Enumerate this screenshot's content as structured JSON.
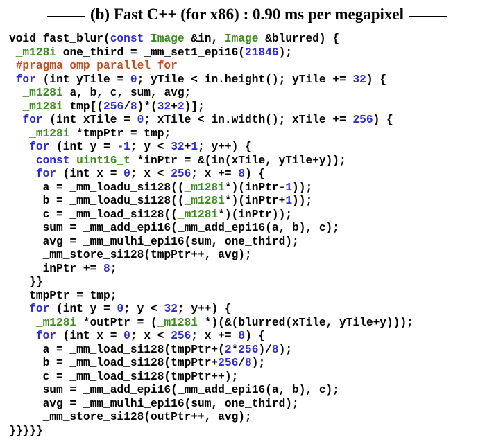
{
  "header": {
    "title": "(b) Fast C++ (for x86) : 0.90 ms per megapixel"
  },
  "colors": {
    "keyword": "#2b2bd6",
    "type": "#3d8a1f",
    "preprocessor": "#c84c1a",
    "number": "#2b2bd6",
    "text": "#000000"
  },
  "code": {
    "lines": [
      [
        [
          "void fast_blur(",
          ""
        ],
        [
          "const",
          "kw"
        ],
        [
          " ",
          ""
        ],
        [
          "Image",
          "ty"
        ],
        [
          " &in, ",
          ""
        ],
        [
          "Image",
          "ty"
        ],
        [
          " &blurred) {",
          ""
        ]
      ],
      [
        [
          " ",
          ""
        ],
        [
          "_m128i",
          "ty"
        ],
        [
          " one_third = _mm_set1_epi16(",
          ""
        ],
        [
          "21846",
          "nm"
        ],
        [
          ");",
          ""
        ]
      ],
      [
        [
          " ",
          ""
        ],
        [
          "#pragma omp parallel for",
          "pp"
        ]
      ],
      [
        [
          " ",
          ""
        ],
        [
          "for",
          "kw"
        ],
        [
          " (int yTile = ",
          ""
        ],
        [
          "0",
          "nm"
        ],
        [
          "; yTile < in.height(); yTile += ",
          ""
        ],
        [
          "32",
          "nm"
        ],
        [
          ") {",
          ""
        ]
      ],
      [
        [
          "  ",
          ""
        ],
        [
          "_m128i",
          "ty"
        ],
        [
          " a, b, c, sum, avg;",
          ""
        ]
      ],
      [
        [
          "  ",
          ""
        ],
        [
          "_m128i",
          "ty"
        ],
        [
          " tmp[(",
          ""
        ],
        [
          "256",
          "nm"
        ],
        [
          "/",
          ""
        ],
        [
          "8",
          "nm"
        ],
        [
          ")*(",
          ""
        ],
        [
          "32",
          "nm"
        ],
        [
          "+",
          ""
        ],
        [
          "2",
          "nm"
        ],
        [
          ")];",
          ""
        ]
      ],
      [
        [
          "  ",
          ""
        ],
        [
          "for",
          "kw"
        ],
        [
          " (int xTile = ",
          ""
        ],
        [
          "0",
          "nm"
        ],
        [
          "; xTile < in.width(); xTile += ",
          ""
        ],
        [
          "256",
          "nm"
        ],
        [
          ") {",
          ""
        ]
      ],
      [
        [
          "   ",
          ""
        ],
        [
          "_m128i",
          "ty"
        ],
        [
          " *tmpPtr = tmp;",
          ""
        ]
      ],
      [
        [
          "   ",
          ""
        ],
        [
          "for",
          "kw"
        ],
        [
          " (int y = ",
          ""
        ],
        [
          "-1",
          "nm"
        ],
        [
          "; y < ",
          ""
        ],
        [
          "32",
          "nm"
        ],
        [
          "+",
          ""
        ],
        [
          "1",
          "nm"
        ],
        [
          "; y++) {",
          ""
        ]
      ],
      [
        [
          "    ",
          ""
        ],
        [
          "const",
          "kw"
        ],
        [
          " ",
          ""
        ],
        [
          "uint16_t",
          "ty"
        ],
        [
          " *inPtr = &(in(xTile, yTile+y));",
          ""
        ]
      ],
      [
        [
          "    ",
          ""
        ],
        [
          "for",
          "kw"
        ],
        [
          " (int x = ",
          ""
        ],
        [
          "0",
          "nm"
        ],
        [
          "; x < ",
          ""
        ],
        [
          "256",
          "nm"
        ],
        [
          "; x += ",
          ""
        ],
        [
          "8",
          "nm"
        ],
        [
          ") {",
          ""
        ]
      ],
      [
        [
          "     a = _mm_loadu_si128((",
          ""
        ],
        [
          "_m128i",
          "ty"
        ],
        [
          "*)(inPtr-",
          ""
        ],
        [
          "1",
          "nm"
        ],
        [
          "));",
          ""
        ]
      ],
      [
        [
          "     b = _mm_loadu_si128((",
          ""
        ],
        [
          "_m128i",
          "ty"
        ],
        [
          "*)(inPtr+",
          ""
        ],
        [
          "1",
          "nm"
        ],
        [
          "));",
          ""
        ]
      ],
      [
        [
          "     c = _mm_load_si128((",
          ""
        ],
        [
          "_m128i",
          "ty"
        ],
        [
          "*)(inPtr));",
          ""
        ]
      ],
      [
        [
          "     sum = _mm_add_epi16(_mm_add_epi16(a, b), c);",
          ""
        ]
      ],
      [
        [
          "     avg = _mm_mulhi_epi16(sum, one_third);",
          ""
        ]
      ],
      [
        [
          "     _mm_store_si128(tmpPtr++, avg);",
          ""
        ]
      ],
      [
        [
          "     inPtr += ",
          ""
        ],
        [
          "8",
          "nm"
        ],
        [
          ";",
          ""
        ]
      ],
      [
        [
          "   }}",
          ""
        ]
      ],
      [
        [
          "   tmpPtr = tmp;",
          ""
        ]
      ],
      [
        [
          "   ",
          ""
        ],
        [
          "for",
          "kw"
        ],
        [
          " (int y = ",
          ""
        ],
        [
          "0",
          "nm"
        ],
        [
          "; y < ",
          ""
        ],
        [
          "32",
          "nm"
        ],
        [
          "; y++) {",
          ""
        ]
      ],
      [
        [
          "    ",
          ""
        ],
        [
          "_m128i",
          "ty"
        ],
        [
          " *outPtr = (",
          ""
        ],
        [
          "_m128i",
          "ty"
        ],
        [
          " *)(&(blurred(xTile, yTile+y)));",
          ""
        ]
      ],
      [
        [
          "    ",
          ""
        ],
        [
          "for",
          "kw"
        ],
        [
          " (int x = ",
          ""
        ],
        [
          "0",
          "nm"
        ],
        [
          "; x < ",
          ""
        ],
        [
          "256",
          "nm"
        ],
        [
          "; x += ",
          ""
        ],
        [
          "8",
          "nm"
        ],
        [
          ") {",
          ""
        ]
      ],
      [
        [
          "     a = _mm_load_si128(tmpPtr+(",
          ""
        ],
        [
          "2",
          "nm"
        ],
        [
          "*",
          ""
        ],
        [
          "256",
          "nm"
        ],
        [
          ")/",
          ""
        ],
        [
          "8",
          "nm"
        ],
        [
          ");",
          ""
        ]
      ],
      [
        [
          "     b = _mm_load_si128(tmpPtr+",
          ""
        ],
        [
          "256",
          "nm"
        ],
        [
          "/",
          ""
        ],
        [
          "8",
          "nm"
        ],
        [
          ");",
          ""
        ]
      ],
      [
        [
          "     c = _mm_load_si128(tmpPtr++);",
          ""
        ]
      ],
      [
        [
          "     sum = _mm_add_epi16(_mm_add_epi16(a, b), c);",
          ""
        ]
      ],
      [
        [
          "     avg = _mm_mulhi_epi16(sum, one_third);",
          ""
        ]
      ],
      [
        [
          "     _mm_store_si128(outPtr++, avg);",
          ""
        ]
      ],
      [
        [
          "}}}}}",
          ""
        ]
      ]
    ]
  }
}
